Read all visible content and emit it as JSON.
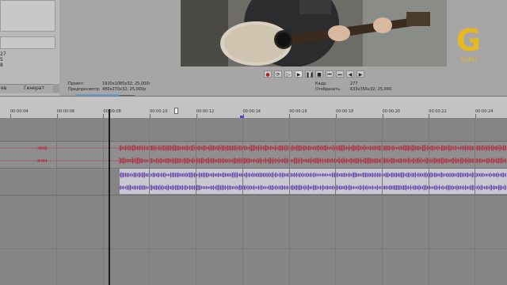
{
  "explorer": {
    "values": [
      "27",
      "5",
      "8"
    ],
    "tabs": [
      "ев",
      "Генерат"
    ]
  },
  "transport": {
    "buttons": [
      {
        "icon": "record-icon",
        "glyph": "●"
      },
      {
        "icon": "loop-icon",
        "glyph": "⟳"
      },
      {
        "icon": "play-from-start-icon",
        "glyph": "▷"
      },
      {
        "icon": "play-icon",
        "glyph": "▶"
      },
      {
        "icon": "pause-icon",
        "glyph": "❚❚"
      },
      {
        "icon": "stop-icon",
        "glyph": "■"
      },
      {
        "icon": "go-to-start-icon",
        "glyph": "⏮"
      },
      {
        "icon": "go-to-end-icon",
        "glyph": "⏭"
      },
      {
        "icon": "previous-frame-icon",
        "glyph": "◀"
      },
      {
        "icon": "next-frame-icon",
        "glyph": "▶"
      },
      {
        "icon": "end-icon",
        "glyph": "⏭"
      }
    ]
  },
  "preview_info": {
    "project_label": "Проект:",
    "project_value": "1920x1080x32; 25,000i",
    "preview_label": "Предпросмотр:",
    "preview_value": "480x270x32; 25,000p",
    "frame_label": "Кадр:",
    "frame_value": "277",
    "display_label": "Отобразить:",
    "display_value": "633x356x32; 25,000",
    "mini_badge": "▶◀"
  },
  "timeline": {
    "ruler_labels": [
      "00:00:04",
      "00:00:06",
      "00:00:08",
      "00:00:10",
      "00:00:12",
      "00:00:14",
      "00:00:16",
      "00:00:18",
      "00:00:20",
      "00:00:22",
      "00:00:24"
    ],
    "colors": {
      "track_red": "#b03048",
      "track_purple": "#6a4aa8",
      "red_bg": "#8f8f8f",
      "purple_bg": "#c8c8d2"
    }
  },
  "logo_letter": "G",
  "logo_text": "tutsi"
}
